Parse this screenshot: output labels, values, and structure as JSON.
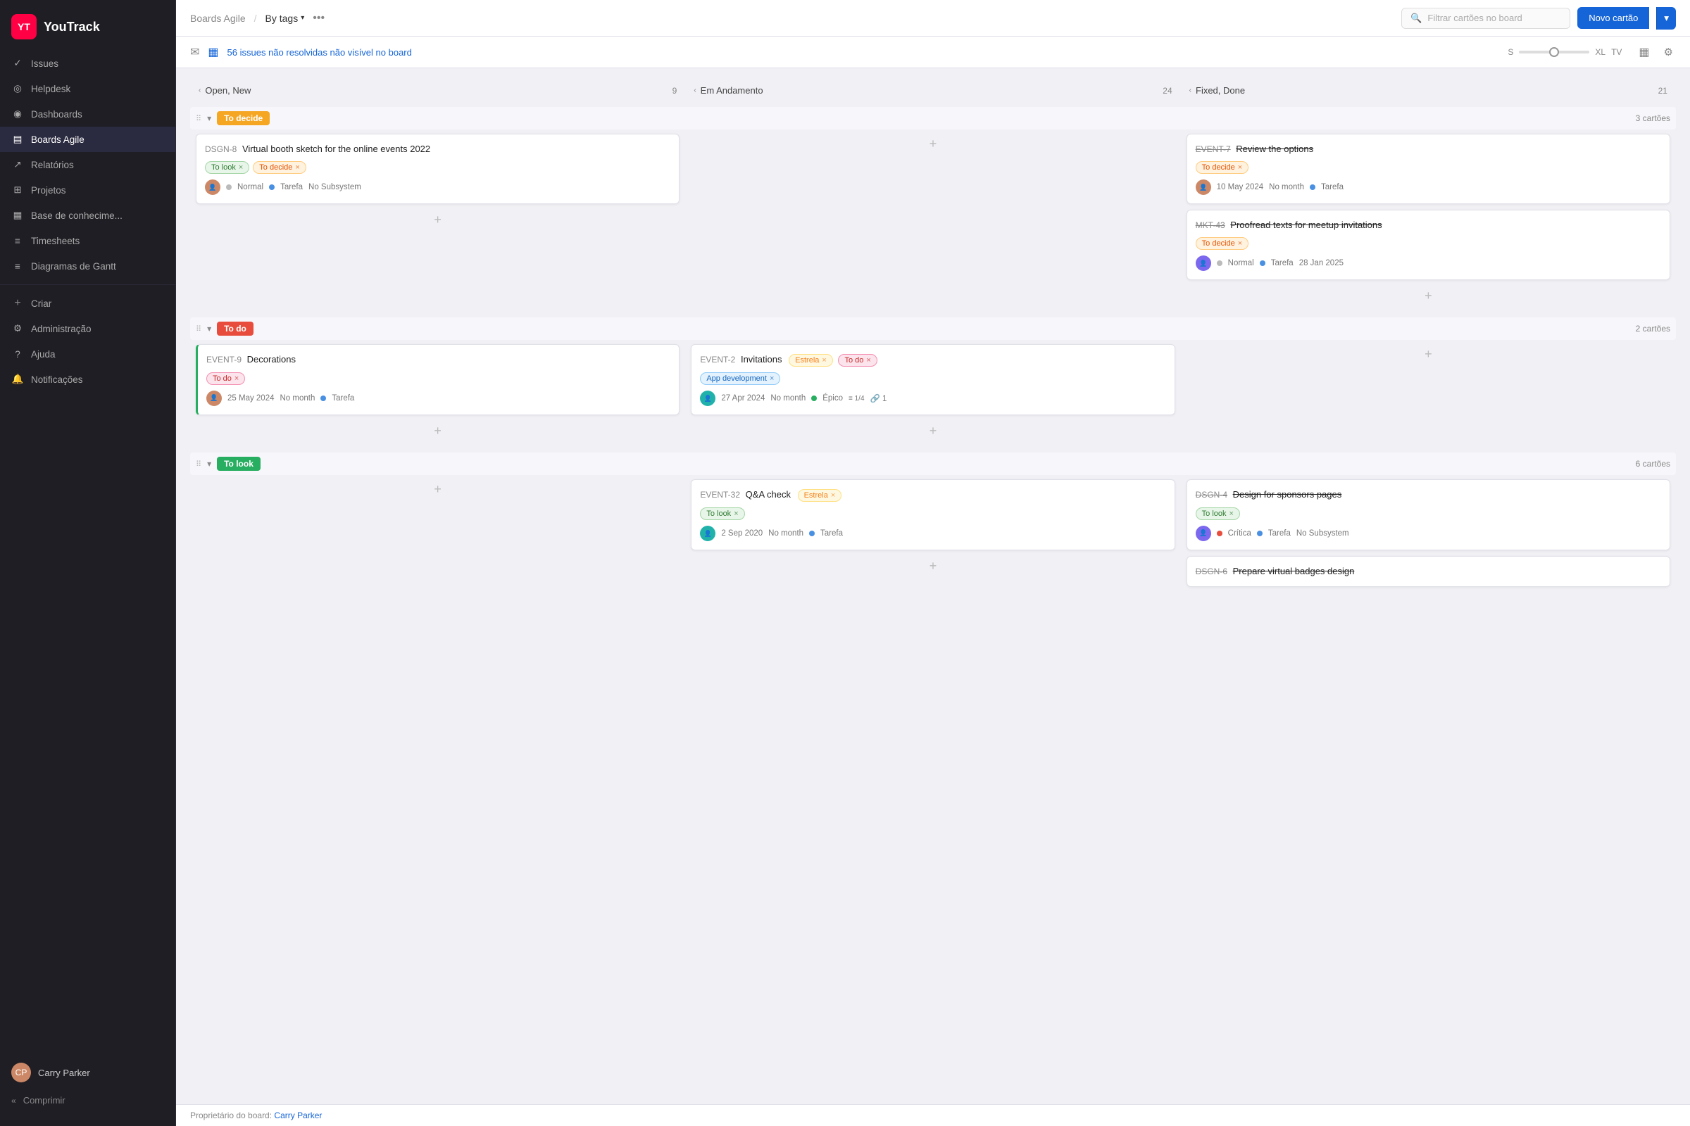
{
  "sidebar": {
    "logo_text": "YouTrack",
    "logo_initials": "YT",
    "nav_items": [
      {
        "id": "issues",
        "label": "Issues",
        "icon": "✓"
      },
      {
        "id": "helpdesk",
        "label": "Helpdesk",
        "icon": "◎"
      },
      {
        "id": "dashboards",
        "label": "Dashboards",
        "icon": "◉"
      },
      {
        "id": "boards-agile",
        "label": "Boards Agile",
        "icon": "▤"
      },
      {
        "id": "relatorios",
        "label": "Relatórios",
        "icon": "↗"
      },
      {
        "id": "projetos",
        "label": "Projetos",
        "icon": "⊞"
      },
      {
        "id": "base",
        "label": "Base de conhecime...",
        "icon": "▦"
      },
      {
        "id": "timesheets",
        "label": "Timesheets",
        "icon": "≡"
      },
      {
        "id": "diagramas",
        "label": "Diagramas de Gantt",
        "icon": "≡"
      }
    ],
    "bottom_items": [
      {
        "id": "criar",
        "label": "Criar",
        "icon": "+"
      },
      {
        "id": "admin",
        "label": "Administração",
        "icon": "⚙"
      },
      {
        "id": "ajuda",
        "label": "Ajuda",
        "icon": "?"
      },
      {
        "id": "notificacoes",
        "label": "Notificações",
        "icon": "🔔"
      }
    ],
    "user_name": "Carry Parker",
    "compress_label": "Comprimir"
  },
  "topbar": {
    "breadcrumb_boards": "Boards Agile",
    "breadcrumb_sep": "/",
    "filter_label": "By tags",
    "more_icon": "•••",
    "search_placeholder": "Filtrar cartões no board",
    "btn_novo": "Novo cartão"
  },
  "issues_bar": {
    "count_text": "56 issues não resolvidas não visível no board",
    "size_s": "S",
    "size_xl": "XL",
    "size_tv": "TV"
  },
  "columns": [
    {
      "id": "open-new",
      "label": "Open, New",
      "count": 9
    },
    {
      "id": "em-andamento",
      "label": "Em Andamento",
      "count": 24
    },
    {
      "id": "fixed-done",
      "label": "Fixed, Done",
      "count": 21
    }
  ],
  "swimlanes": [
    {
      "id": "to-decide",
      "tag": "To decide",
      "tag_class": "tag-to-decide",
      "cards_count": "3 cartões",
      "cards": {
        "open_new": [
          {
            "id": "DSGN-8",
            "title": "Virtual booth sketch for the online events 2022",
            "strikethrough": false,
            "chips": [
              "To look",
              "To decide"
            ],
            "avatar_class": "card-avatar",
            "meta_normal": "Normal",
            "meta_tarefa": "Tarefa",
            "meta_subsystem": "No Subsystem",
            "dot_class": "meta-dot-gray"
          }
        ],
        "em_andamento": [],
        "fixed_done": [
          {
            "id": "EVENT-7",
            "title": "Review the options",
            "strikethrough": true,
            "chips": [
              "To decide"
            ],
            "avatar_class": "card-avatar",
            "meta_date": "10 May 2024",
            "meta_month": "No month",
            "meta_tarefa": "Tarefa",
            "dot_class": "meta-dot-blue"
          },
          {
            "id": "MKT-43",
            "title": "Proofread texts for meetup invitations",
            "strikethrough": true,
            "chips": [
              "To decide"
            ],
            "avatar_class": "card-avatar card-avatar-2",
            "meta_normal": "Normal",
            "meta_tarefa": "Tarefa",
            "meta_date": "28 Jan 2025",
            "dot_class": "meta-dot-gray"
          }
        ]
      }
    },
    {
      "id": "to-do",
      "tag": "To do",
      "tag_class": "tag-to-do",
      "cards_count": "2 cartões",
      "cards": {
        "open_new": [
          {
            "id": "EVENT-9",
            "title": "Decorations",
            "strikethrough": false,
            "chips": [
              "To do"
            ],
            "avatar_class": "card-avatar",
            "meta_date": "25 May 2024",
            "meta_month": "No month",
            "meta_tarefa": "Tarefa",
            "dot_class": "meta-dot-blue"
          }
        ],
        "em_andamento": [
          {
            "id": "EVENT-2",
            "title": "Invitations",
            "strikethrough": false,
            "chips": [
              "Estrela",
              "To do",
              "App development"
            ],
            "avatar_class": "card-avatar card-avatar-3",
            "meta_date": "27 Apr 2024",
            "meta_month": "No month",
            "meta_tarefa": "Épico",
            "meta_extra": "1/4",
            "meta_attach": "1",
            "dot_class": "meta-dot-green"
          }
        ],
        "fixed_done": []
      }
    },
    {
      "id": "to-look",
      "tag": "To look",
      "tag_class": "tag-to-look",
      "cards_count": "6 cartões",
      "cards": {
        "open_new": [],
        "em_andamento": [
          {
            "id": "EVENT-32",
            "title": "Q&A check",
            "strikethrough": false,
            "chips": [
              "Estrela",
              "To look"
            ],
            "avatar_class": "card-avatar card-avatar-3",
            "meta_date": "2 Sep 2020",
            "meta_month": "No month",
            "meta_tarefa": "Tarefa",
            "dot_class": "meta-dot-blue"
          }
        ],
        "fixed_done": [
          {
            "id": "DSGN-4",
            "title": "Design for sponsors pages",
            "strikethrough": true,
            "chips": [
              "To look"
            ],
            "avatar_class": "card-avatar card-avatar-2",
            "meta_critica": "Crítica",
            "meta_tarefa": "Tarefa",
            "meta_subsystem": "No Subsystem",
            "dot_class": "meta-dot-red"
          },
          {
            "id": "DSGN-6",
            "title": "Prepare virtual badges design",
            "strikethrough": true,
            "chips": [],
            "avatar_class": "card-avatar",
            "meta_date": "",
            "dot_class": "meta-dot-gray"
          }
        ]
      }
    }
  ],
  "footer": {
    "owner_label": "Proprietário do board:",
    "owner_name": "Carry Parker"
  }
}
